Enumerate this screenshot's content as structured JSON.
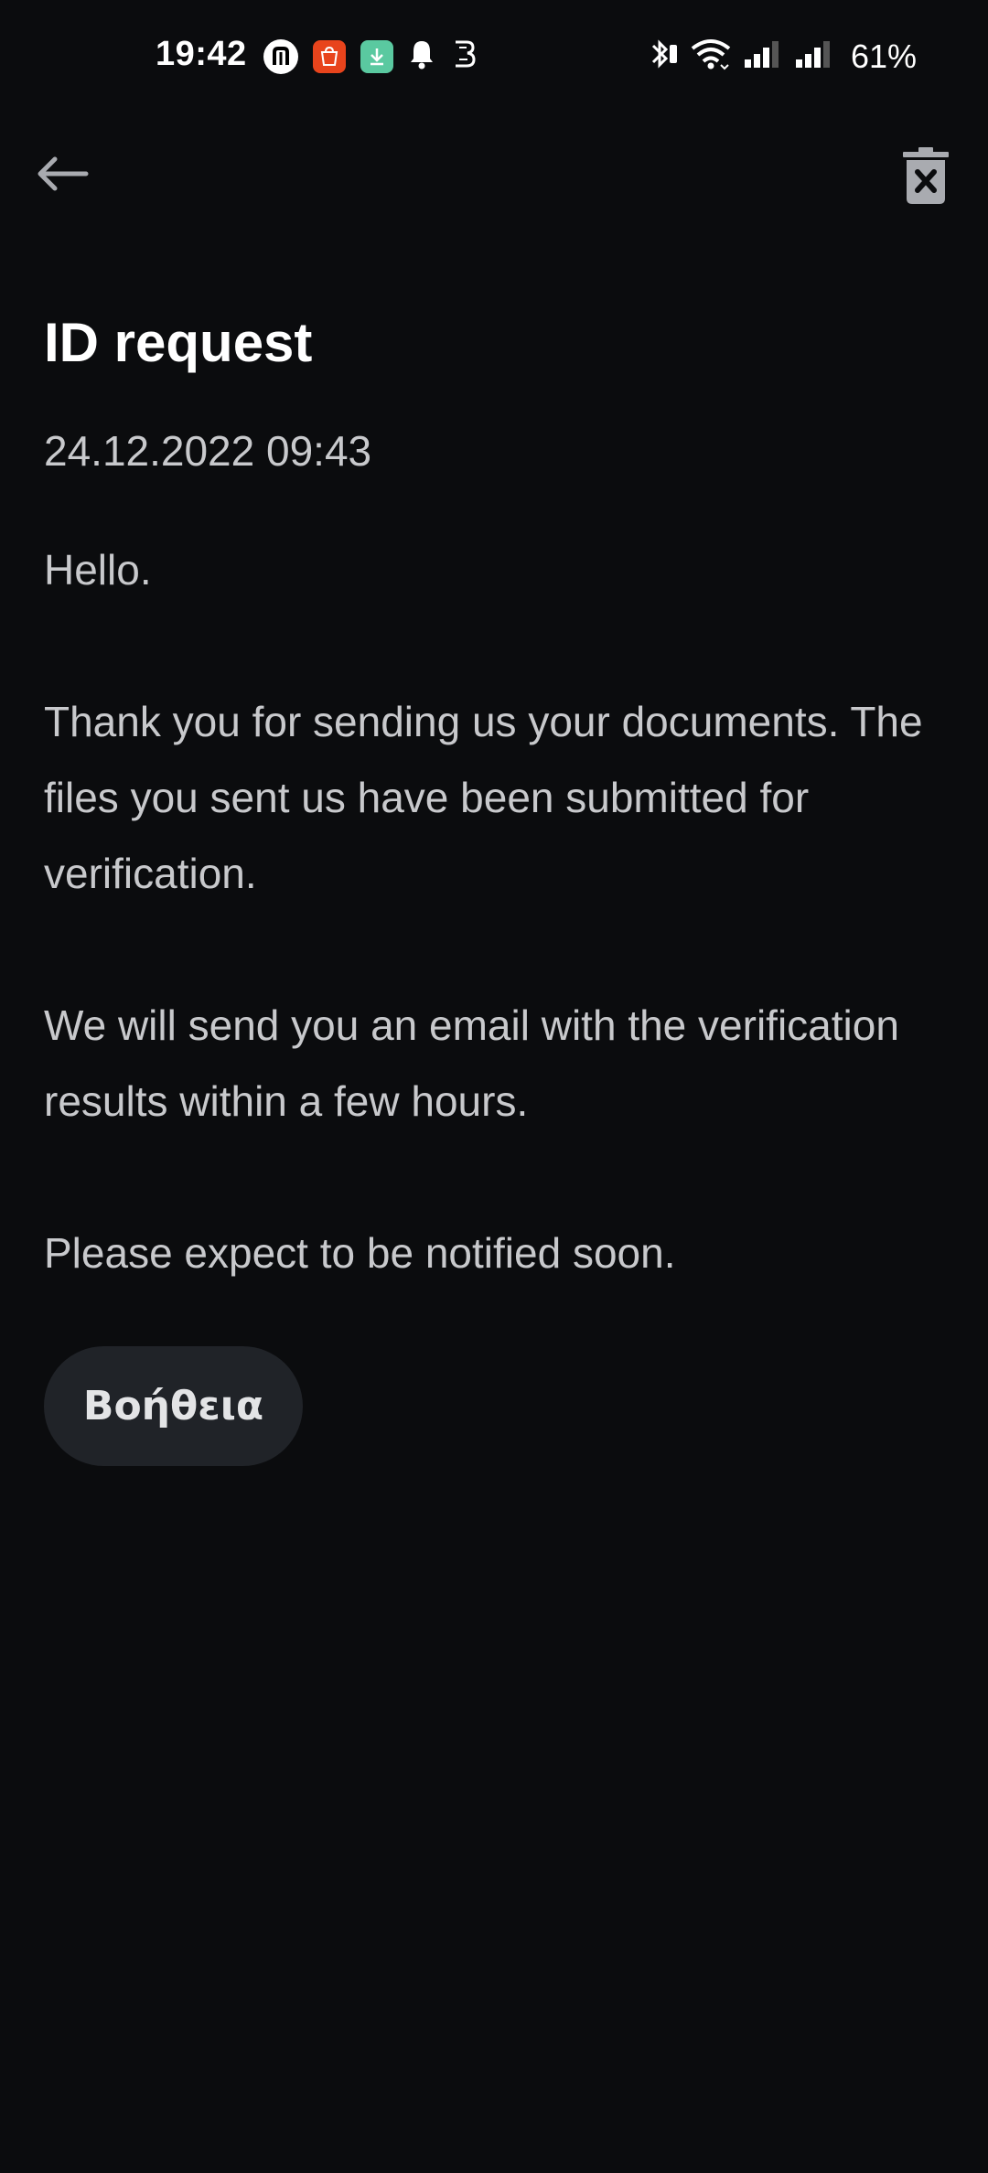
{
  "status_bar": {
    "time": "19:42",
    "battery": "61%",
    "left_icons": [
      "n-app-icon",
      "shop-app-icon",
      "download-app-icon",
      "bell-icon",
      "b-app-icon"
    ],
    "right_icons": [
      "bluetooth-icon",
      "wifi-icon",
      "signal-icon",
      "signal-icon"
    ]
  },
  "toolbar": {
    "back_icon": "arrow-left-icon",
    "delete_icon": "trash-icon"
  },
  "message": {
    "title": "ID request",
    "date": "24.12.2022 09:43",
    "paragraphs": [
      "Hello.",
      "Thank you for sending us your documents. The files you sent us have been submitted for verification.",
      "We will send you an email with the verification results within a few hours.",
      "Please expect to be notified soon."
    ]
  },
  "actions": {
    "help_label": "Βοήθεια"
  },
  "colors": {
    "background": "#0b0c0e",
    "title": "#ffffff",
    "body_text": "#c8c9cc",
    "button_bg": "#202328"
  }
}
